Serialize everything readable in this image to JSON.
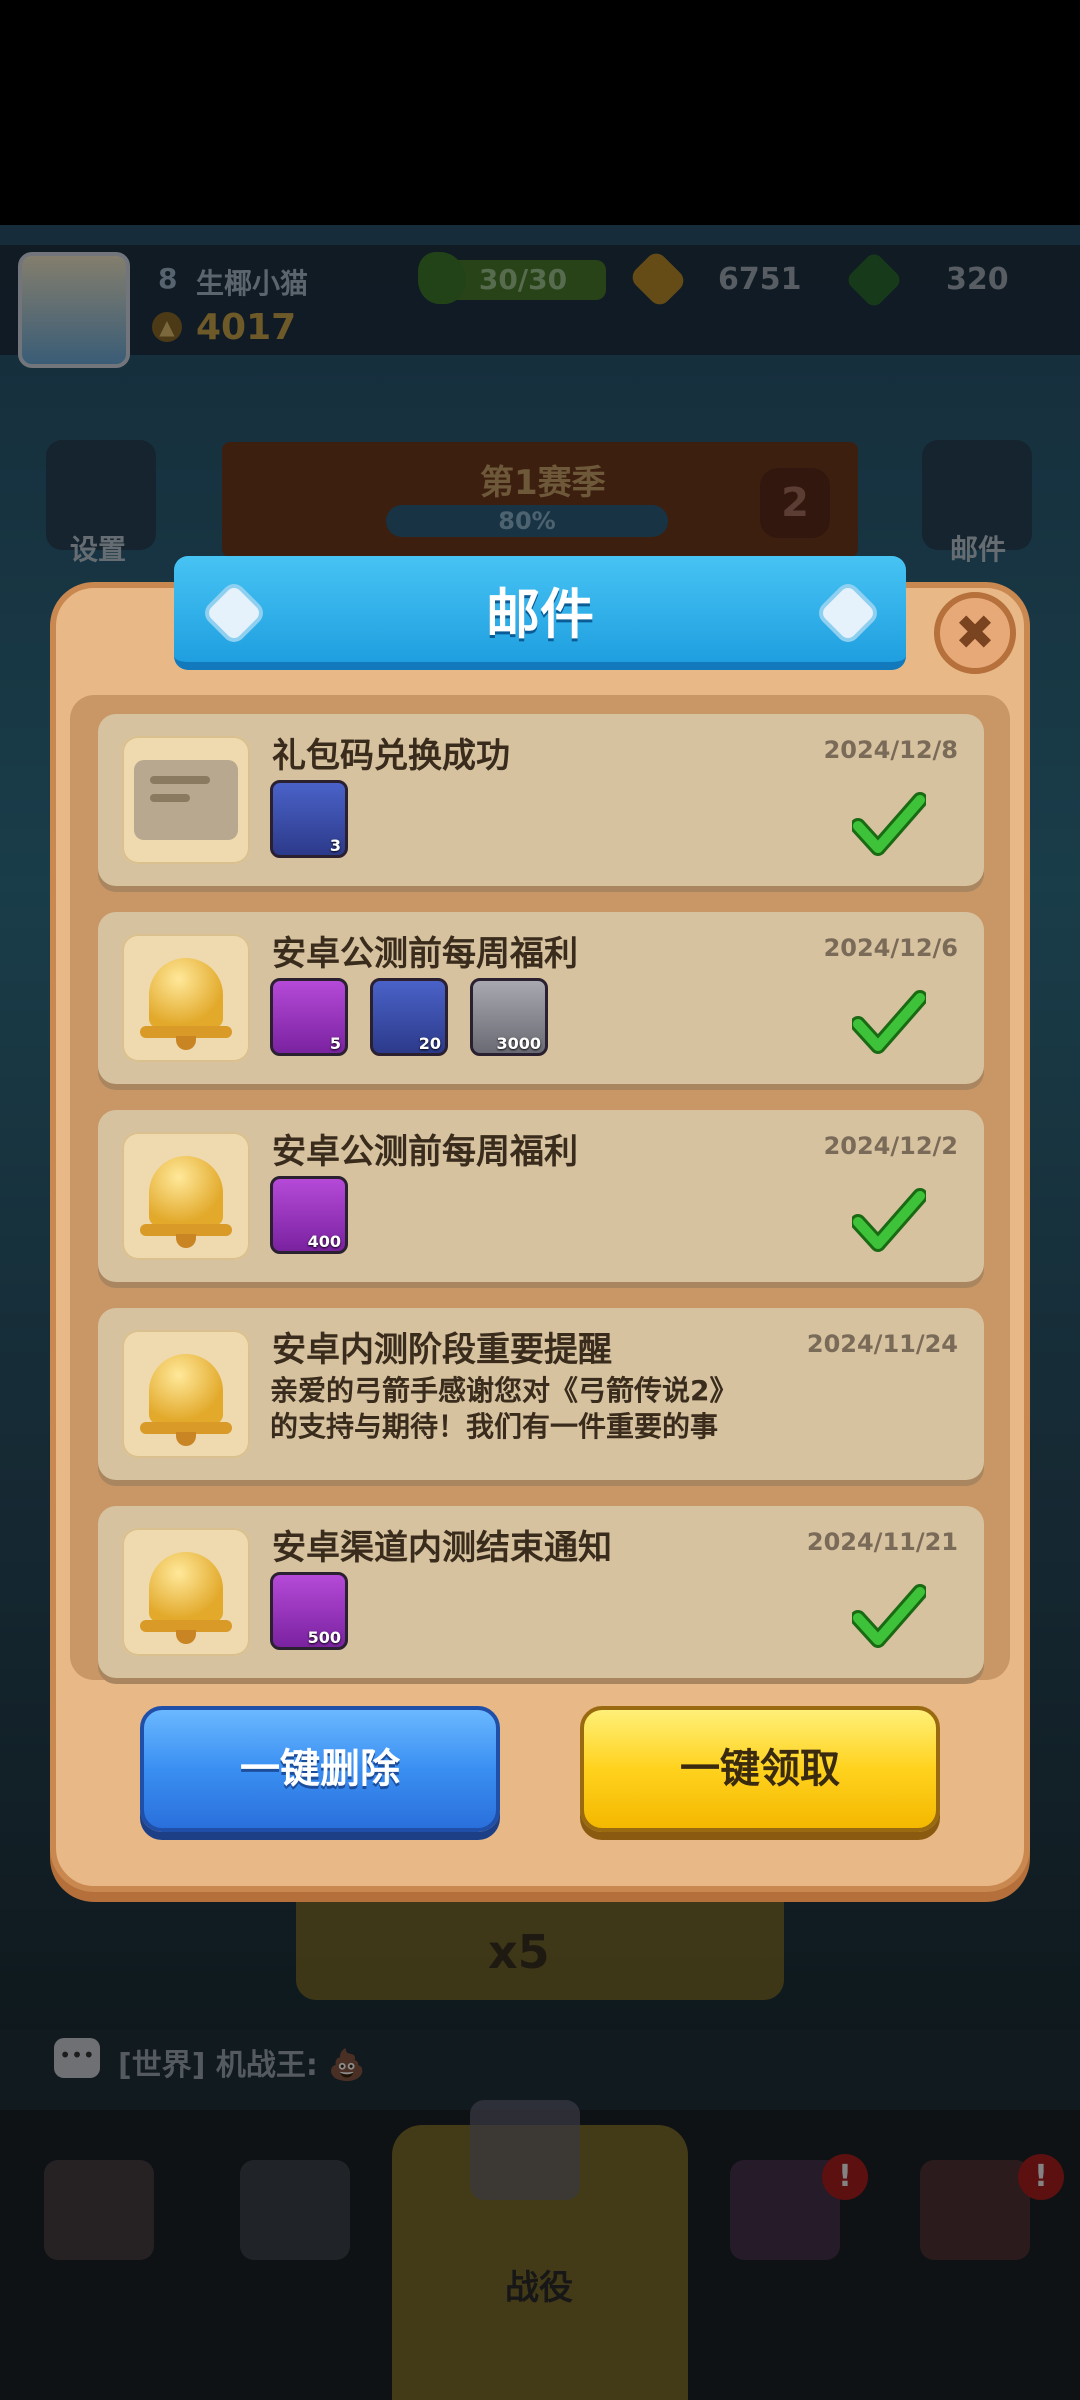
{
  "header": {
    "level": "8",
    "player_name": "生椰小猫",
    "power": "4017",
    "energy": "30/30",
    "coins": "6751",
    "gems": "320"
  },
  "side": {
    "settings_label": "设置",
    "mail_label": "邮件"
  },
  "season": {
    "title": "第1赛季",
    "progress": "80%",
    "level": "2"
  },
  "modal": {
    "title": "邮件",
    "close_glyph": "✖",
    "items": [
      {
        "title": "礼包码兑换成功",
        "date": "2024/12/8",
        "rewards": [
          {
            "icon": "key-icon",
            "qty": "3"
          }
        ],
        "claimed": true
      },
      {
        "title": "安卓公测前每周福利",
        "date": "2024/12/6",
        "rewards": [
          {
            "icon": "golden-key-icon",
            "qty": "5"
          },
          {
            "icon": "scroll-icon",
            "qty": "20"
          },
          {
            "icon": "coin-icon",
            "qty": "3000"
          }
        ],
        "claimed": true
      },
      {
        "title": "安卓公测前每周福利",
        "date": "2024/12/2",
        "rewards": [
          {
            "icon": "gem-icon",
            "qty": "400"
          }
        ],
        "claimed": true
      },
      {
        "title": "安卓内测阶段重要提醒",
        "date": "2024/11/24",
        "body_line1": "亲爱的弓箭手感谢您对《弓箭传说2》",
        "body_line2": "的支持与期待！我们有一件重要的事"
      },
      {
        "title": "安卓渠道内测结束通知",
        "date": "2024/11/21",
        "rewards": [
          {
            "icon": "gem-icon",
            "qty": "500"
          }
        ],
        "claimed": true
      }
    ],
    "delete_all": "一键删除",
    "claim_all": "一键领取"
  },
  "background": {
    "reward_text": "x5",
    "chat_text": "[世界] 机战王: 💩",
    "nav_active_label": "战役",
    "badge_glyph": "!"
  },
  "colors": {
    "title_bar": "#1f9fe0",
    "panel": "#e8b887",
    "delete_button": "#3a8ff2",
    "claim_button": "#ffd21e",
    "check": "#2fb42a"
  }
}
